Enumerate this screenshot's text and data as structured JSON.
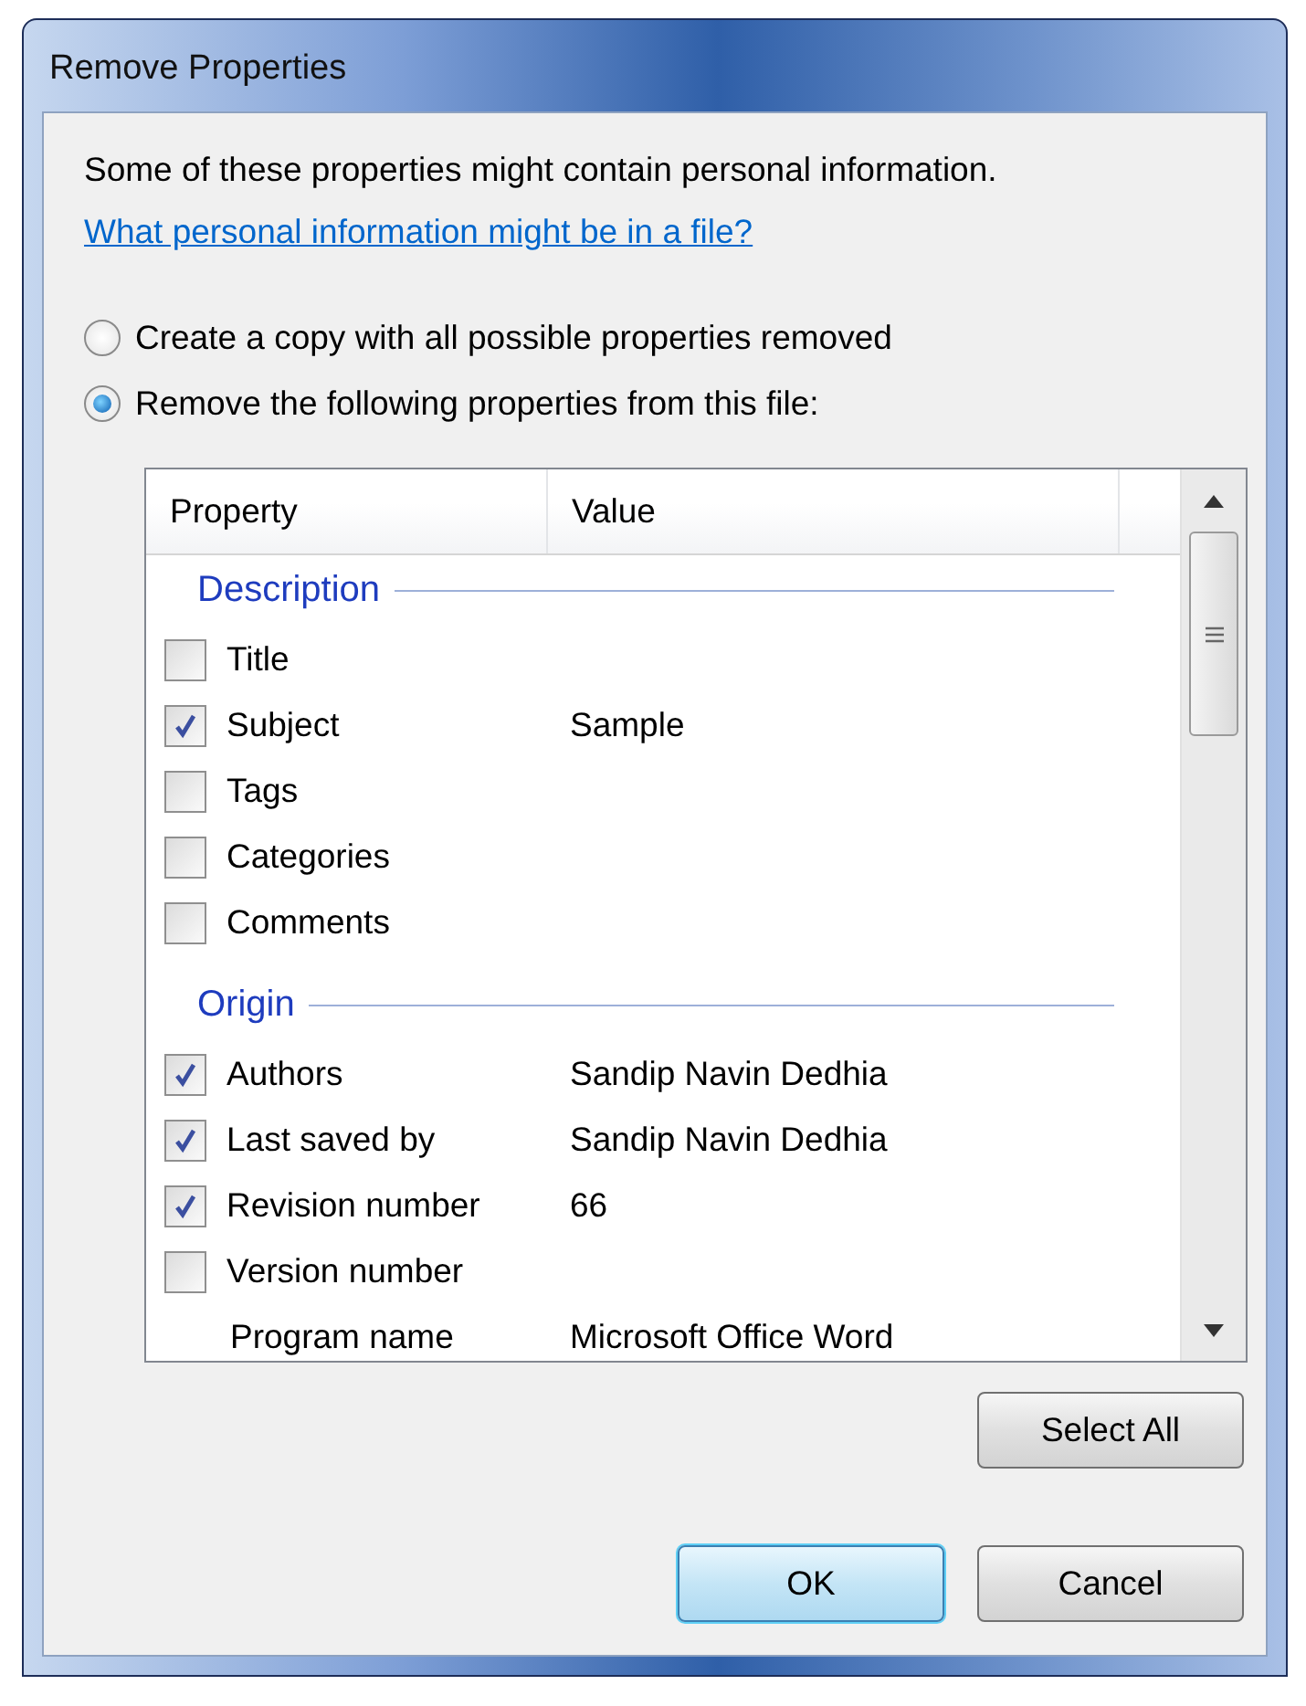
{
  "window": {
    "title": "Remove Properties"
  },
  "intro": "Some of these properties might contain personal information.",
  "help_link": "What personal information might be in a file?",
  "options": [
    {
      "label": "Create a copy with all possible properties removed",
      "selected": false
    },
    {
      "label": "Remove the following properties from this file:",
      "selected": true
    }
  ],
  "list": {
    "columns": [
      "Property",
      "Value"
    ],
    "groups": [
      {
        "name": "Description",
        "items": [
          {
            "kind": "checkbox",
            "property": "Title",
            "checked": false
          },
          {
            "kind": "checkbox",
            "property": "Subject",
            "value": "Sample",
            "checked": true
          },
          {
            "kind": "checkbox",
            "property": "Tags",
            "checked": false
          },
          {
            "kind": "checkbox",
            "property": "Categories",
            "checked": false
          },
          {
            "kind": "checkbox",
            "property": "Comments",
            "checked": false
          }
        ]
      },
      {
        "name": "Origin",
        "items": [
          {
            "kind": "checkbox",
            "property": "Authors",
            "value": "Sandip Navin Dedhia",
            "checked": true
          },
          {
            "kind": "checkbox",
            "property": "Last saved by",
            "value": "Sandip Navin Dedhia",
            "checked": true
          },
          {
            "kind": "checkbox",
            "property": "Revision number",
            "value": "66",
            "checked": true
          },
          {
            "kind": "checkbox",
            "property": "Version number",
            "checked": false
          },
          {
            "kind": "plain",
            "property": "Program name",
            "value": "Microsoft Office Word"
          }
        ]
      }
    ]
  },
  "buttons": {
    "select_all": "Select All",
    "ok": "OK",
    "cancel": "Cancel"
  }
}
